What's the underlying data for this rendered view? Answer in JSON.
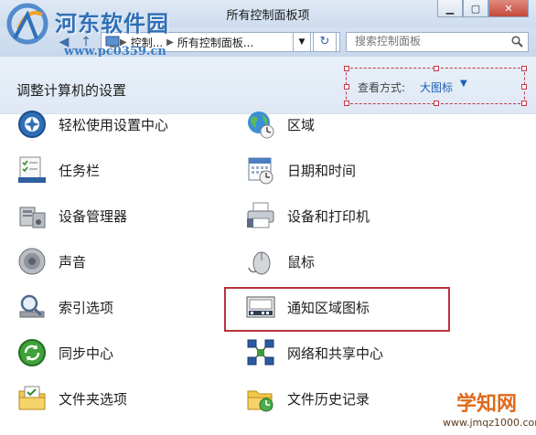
{
  "window": {
    "title": "所有控制面板项"
  },
  "watermark": {
    "brand": "河东软件园",
    "url": "www.pc0359.cn"
  },
  "nav": {
    "breadcrumbs": [
      "控制...",
      "所有控制面板..."
    ],
    "search_placeholder": "搜索控制面板"
  },
  "header": {
    "title": "调整计算机的设置",
    "view_label": "查看方式:",
    "view_value": "大图标"
  },
  "items": [
    {
      "label": "轻松使用设置中心",
      "icon": "ease-of-access-icon"
    },
    {
      "label": "区域",
      "icon": "region-globe-icon"
    },
    {
      "label": "任务栏",
      "icon": "taskbar-icon"
    },
    {
      "label": "日期和时间",
      "icon": "date-time-icon"
    },
    {
      "label": "设备管理器",
      "icon": "device-manager-icon"
    },
    {
      "label": "设备和打印机",
      "icon": "printer-icon"
    },
    {
      "label": "声音",
      "icon": "speaker-icon"
    },
    {
      "label": "鼠标",
      "icon": "mouse-icon"
    },
    {
      "label": "索引选项",
      "icon": "indexing-icon"
    },
    {
      "label": "通知区域图标",
      "icon": "notification-area-icon"
    },
    {
      "label": "同步中心",
      "icon": "sync-center-icon"
    },
    {
      "label": "网络和共享中心",
      "icon": "network-icon"
    },
    {
      "label": "文件夹选项",
      "icon": "folder-options-icon"
    },
    {
      "label": "文件历史记录",
      "icon": "file-history-icon"
    }
  ],
  "site_brand": {
    "name": "学知网",
    "url": "www.jmqz1000.com"
  },
  "colors": {
    "highlight": "#b8323b",
    "accent": "#1a5fb4"
  }
}
